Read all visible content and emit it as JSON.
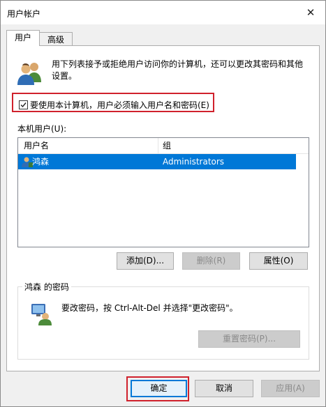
{
  "window": {
    "title": "用户帐户",
    "close_glyph": "✕"
  },
  "tabs": [
    {
      "label": "用户",
      "active": true
    },
    {
      "label": "高级",
      "active": false
    }
  ],
  "users_tab": {
    "description": "用下列表接予或拒绝用户访问你的计算机，还可以更改其密码和其他设置。",
    "require_login": {
      "label": "要使用本计算机，用户必须输入用户名和密码(E)",
      "checked": true
    },
    "local_users_label": "本机用户(U):",
    "list": {
      "columns": [
        "用户名",
        "组"
      ],
      "rows": [
        {
          "name": "鸿森",
          "group": "Administrators",
          "selected": true
        }
      ]
    },
    "buttons": {
      "add": "添加(D)...",
      "remove": "删除(R)",
      "properties": "属性(O)"
    },
    "password_group": {
      "title": "鸿森 的密码",
      "text": "要改密码，按 Ctrl-Alt-Del 并选择\"更改密码\"。",
      "reset_button": "重置密码(P)..."
    }
  },
  "footer": {
    "ok": "确定",
    "cancel": "取消",
    "apply": "应用(A)"
  },
  "colors": {
    "accent": "#0078d7",
    "highlight_border": "#d0212c",
    "selection": "#0078d7"
  },
  "icons": {
    "users": "users-icon",
    "user_row": "user-icon",
    "password": "password-key-icon",
    "close": "close-icon",
    "check": "checkmark-icon"
  }
}
